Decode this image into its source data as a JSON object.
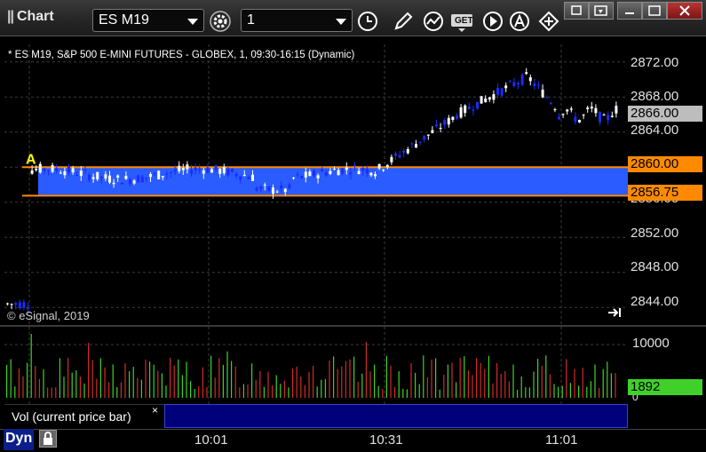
{
  "window": {
    "title": "Chart",
    "pipes": "||"
  },
  "toolbar": {
    "symbol": "ES M19",
    "interval": "1",
    "get_label": "GET"
  },
  "chart": {
    "legend": "* ES M19, S&P 500 E-MINI FUTURES - GLOBEX, 1, 09:30-16:15 (Dynamic)",
    "copyright": "© eSignal, 2019",
    "marker_label": "A",
    "y_ticks": [
      "2872.00",
      "2868.00",
      "2864.00",
      "2860.00",
      "2856.00",
      "2852.00",
      "2848.00",
      "2844.00"
    ],
    "current_price": "2866.00",
    "upper_level": "2860.00",
    "lower_level": "2856.75",
    "zone_color": "#2a5cff",
    "level_color": "#ff8a00",
    "up_color": "#ffffff",
    "down_color": "#1a2cff"
  },
  "volume": {
    "label": "Vol (current price bar)",
    "close_symbol": "×",
    "y_ticks": [
      "10000",
      "0"
    ],
    "current_value": "1892",
    "current_color": "#3fd12a",
    "up_color": "#3fd12a",
    "down_color": "#d12a2a"
  },
  "x_axis": {
    "ticks": [
      "10:01",
      "10:31",
      "11:01"
    ]
  },
  "status": {
    "mode": "Dyn"
  }
}
